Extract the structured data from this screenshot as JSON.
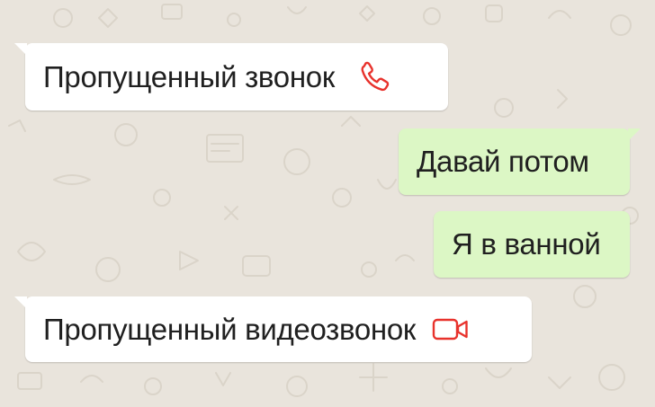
{
  "chat": {
    "messages": [
      {
        "direction": "incoming",
        "text": "Пропущенный звонок",
        "icon": "missed-voice-call-icon"
      },
      {
        "direction": "outgoing",
        "text": "Давай потом"
      },
      {
        "direction": "outgoing",
        "text": "Я в ванной"
      },
      {
        "direction": "incoming",
        "text": "Пропущенный видеозвонок",
        "icon": "missed-video-call-icon"
      }
    ]
  },
  "colors": {
    "background": "#e9e4dc",
    "incoming_bubble": "#ffffff",
    "outgoing_bubble": "#dcf7c5",
    "missed_call_red": "#e8322c",
    "text": "#202020"
  }
}
